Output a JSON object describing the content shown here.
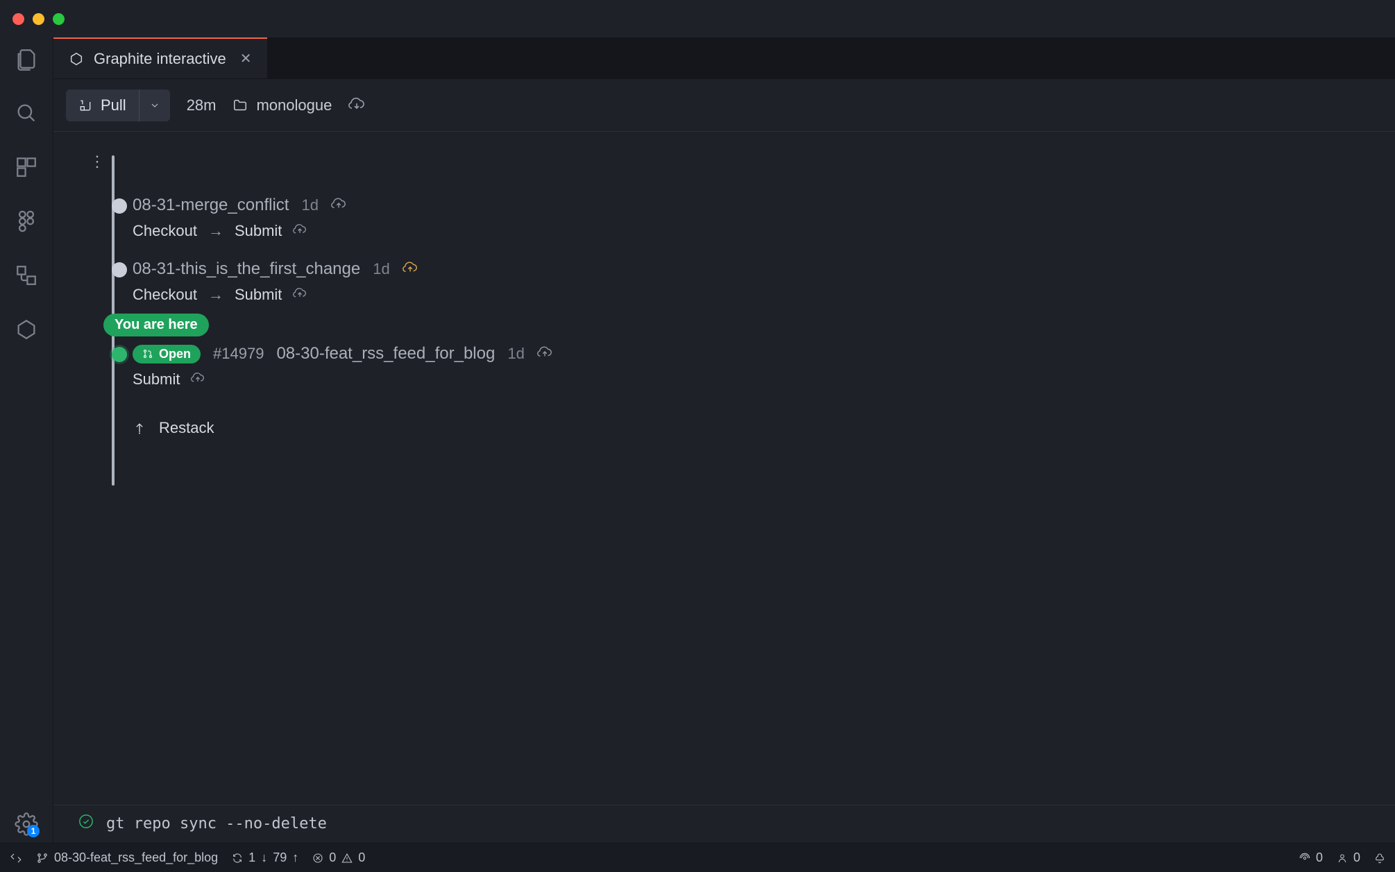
{
  "window": {
    "traffic_light_colors": [
      "#ff5f57",
      "#febc2e",
      "#28c840"
    ]
  },
  "activitybar": {
    "icons": [
      "files",
      "search",
      "extensions",
      "figma",
      "ports",
      "graphite"
    ],
    "settings_badge": "1"
  },
  "tab": {
    "label": "Graphite interactive"
  },
  "toolbar": {
    "pull_label": "Pull",
    "time_since": "28m",
    "repo_name": "monologue"
  },
  "stack": {
    "you_are_here": "You are here",
    "restack_label": "Restack",
    "branches": [
      {
        "name": "08-31-merge_conflict",
        "age": "1d",
        "cloud_variant": "default",
        "actions": [
          "Checkout",
          "Submit"
        ],
        "current": false
      },
      {
        "name": "08-31-this_is_the_first_change",
        "age": "1d",
        "cloud_variant": "orange",
        "actions": [
          "Checkout",
          "Submit"
        ],
        "current": false
      },
      {
        "name": "08-30-feat_rss_feed_for_blog",
        "age": "1d",
        "cloud_variant": "default",
        "pr_status": "Open",
        "pr_number": "#14979",
        "actions": [
          "Submit"
        ],
        "current": true
      }
    ]
  },
  "command": {
    "text": "gt repo sync --no-delete"
  },
  "statusbar": {
    "branch": "08-30-feat_rss_feed_for_blog",
    "incoming": "1",
    "outgoing": "79",
    "errors": "0",
    "warnings": "0",
    "ports": "0",
    "live_share": "0"
  }
}
